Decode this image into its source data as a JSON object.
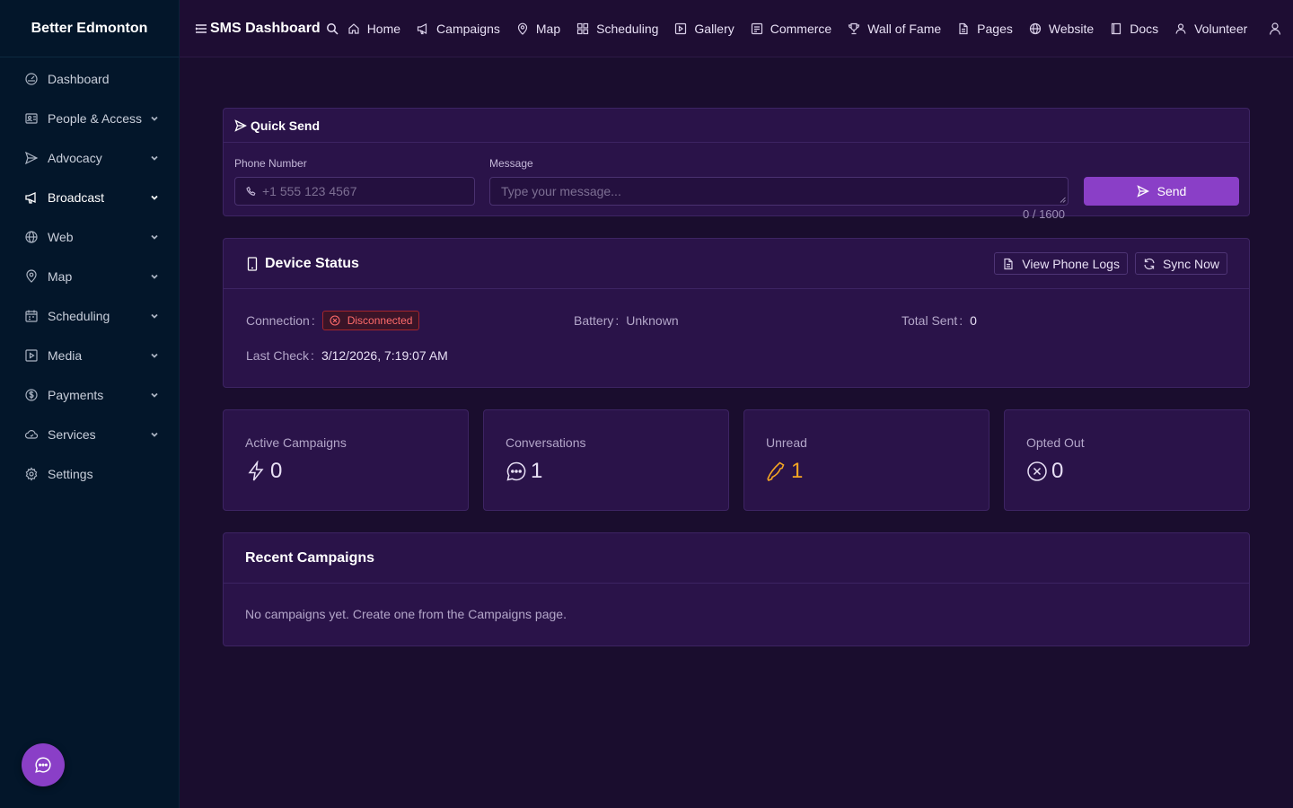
{
  "brand": "Better Edmonton",
  "sidebar": {
    "items": [
      {
        "label": "Dashboard",
        "icon": "dashboard-icon",
        "chevron": false
      },
      {
        "label": "People & Access",
        "icon": "people-icon",
        "chevron": true
      },
      {
        "label": "Advocacy",
        "icon": "send-icon",
        "chevron": true
      },
      {
        "label": "Broadcast",
        "icon": "megaphone-icon",
        "chevron": true,
        "active": true
      },
      {
        "label": "Web",
        "icon": "globe-icon",
        "chevron": true
      },
      {
        "label": "Map",
        "icon": "map-pin-icon",
        "chevron": true
      },
      {
        "label": "Scheduling",
        "icon": "calendar-icon",
        "chevron": true
      },
      {
        "label": "Media",
        "icon": "play-square-icon",
        "chevron": true
      },
      {
        "label": "Payments",
        "icon": "dollar-circle-icon",
        "chevron": true
      },
      {
        "label": "Services",
        "icon": "cloud-icon",
        "chevron": true
      },
      {
        "label": "Settings",
        "icon": "gear-icon",
        "chevron": false
      }
    ]
  },
  "topbar": {
    "title": "SMS Dashboard",
    "nav": [
      {
        "label": "Home",
        "icon": "home-icon"
      },
      {
        "label": "Campaigns",
        "icon": "megaphone-icon"
      },
      {
        "label": "Map",
        "icon": "map-pin-icon"
      },
      {
        "label": "Scheduling",
        "icon": "grid-icon"
      },
      {
        "label": "Gallery",
        "icon": "play-square-icon"
      },
      {
        "label": "Commerce",
        "icon": "store-icon"
      },
      {
        "label": "Wall of Fame",
        "icon": "trophy-icon"
      },
      {
        "label": "Pages",
        "icon": "file-icon"
      },
      {
        "label": "Website",
        "icon": "globe-icon"
      },
      {
        "label": "Docs",
        "icon": "book-icon"
      },
      {
        "label": "Volunteer",
        "icon": "volunteer-icon"
      }
    ]
  },
  "quick_send": {
    "title": "Quick Send",
    "phone_label": "Phone Number",
    "phone_placeholder": "+1 555 123 4567",
    "message_label": "Message",
    "message_placeholder": "Type your message...",
    "counter": "0 / 1600",
    "send_label": "Send"
  },
  "device_status": {
    "title": "Device Status",
    "view_logs_label": "View Phone Logs",
    "sync_label": "Sync Now",
    "connection_label": "Connection",
    "connection_value": "Disconnected",
    "battery_label": "Battery",
    "battery_value": "Unknown",
    "total_sent_label": "Total Sent",
    "total_sent_value": "0",
    "last_check_label": "Last Check",
    "last_check_value": "3/12/2026, 7:19:07 AM"
  },
  "stats": [
    {
      "label": "Active Campaigns",
      "value": "0",
      "icon": "lightning-icon",
      "color": "#e8e0f5"
    },
    {
      "label": "Conversations",
      "value": "1",
      "icon": "chat-icon",
      "color": "#e8e0f5"
    },
    {
      "label": "Unread",
      "value": "1",
      "icon": "phone-icon",
      "color": "#f5a623"
    },
    {
      "label": "Opted Out",
      "value": "0",
      "icon": "x-circle-icon",
      "color": "#e8e0f5"
    }
  ],
  "recent_campaigns": {
    "title": "Recent Campaigns",
    "empty_text": "No campaigns yet. Create one from the Campaigns page."
  },
  "colors": {
    "accent": "#8a3fc7",
    "sidebar_bg": "#03162a",
    "card_bg": "#2a1349",
    "danger": "#ff6b6b",
    "warning": "#f5a623"
  }
}
